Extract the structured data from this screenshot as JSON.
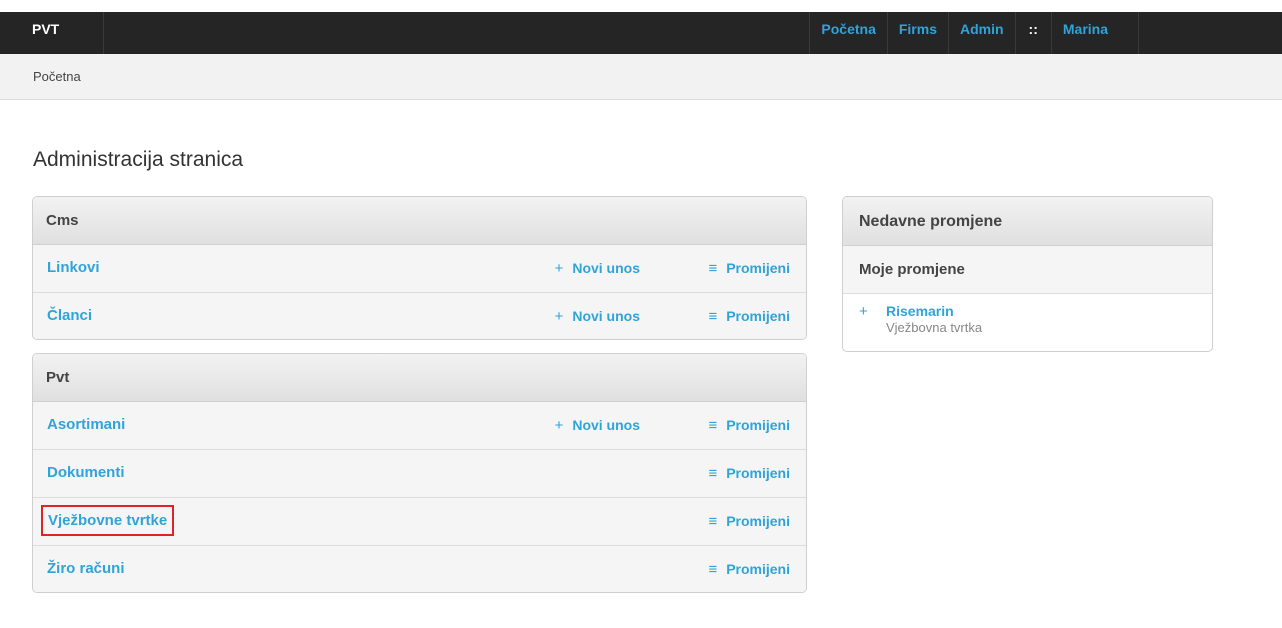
{
  "topbar": {
    "brand": "PVT",
    "nav": [
      {
        "label": "Početna"
      },
      {
        "label": "Firms"
      },
      {
        "label": "Admin"
      },
      {
        "label": "::"
      },
      {
        "label": "Marina"
      }
    ]
  },
  "breadcrumb": "Početna",
  "page_title": "Administracija stranica",
  "modules": [
    {
      "title": "Cms",
      "rows": [
        {
          "label": "Linkovi",
          "add": "Novi unos",
          "change": "Promijeni"
        },
        {
          "label": "Članci",
          "add": "Novi unos",
          "change": "Promijeni"
        }
      ]
    },
    {
      "title": "Pvt",
      "rows": [
        {
          "label": "Asortimani",
          "add": "Novi unos",
          "change": "Promijeni"
        },
        {
          "label": "Dokumenti",
          "change": "Promijeni"
        },
        {
          "label": "Vježbovne tvrtke",
          "change": "Promijeni"
        },
        {
          "label": "Žiro računi",
          "change": "Promijeni"
        }
      ]
    }
  ],
  "glyphs": {
    "add": "+",
    "change": "≡"
  },
  "recent": {
    "title": "Nedavne promjene",
    "subtitle": "Moje promjene",
    "items": [
      {
        "label": "Risemarin",
        "type": "Vježbovna tvrtka"
      }
    ]
  }
}
